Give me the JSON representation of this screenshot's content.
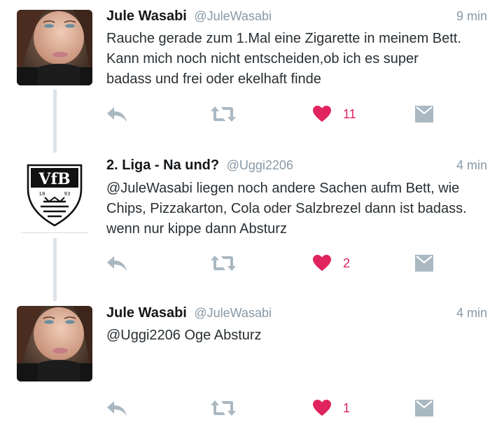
{
  "tweets": [
    {
      "name": "Jule Wasabi",
      "handle": "@JuleWasabi",
      "time": "9 min",
      "text_lines": [
        "Rauche gerade zum 1.Mal eine Zigarette in meinem Bett.",
        "Kann mich noch nicht entscheiden,ob ich es super",
        "badass und frei oder ekelhaft finde"
      ],
      "likes": "11",
      "avatar": "photo-avatar"
    },
    {
      "name": "2. Liga - Na und?",
      "handle": "@Uggi2206",
      "time": "4 min",
      "text_lines": [
        "@JuleWasabi liegen noch andere Sachen aufm Bett, wie",
        "Chips, Pizzakarton, Cola oder Salzbrezel dann ist badass.",
        "wenn nur kippe dann Absturz"
      ],
      "likes": "2",
      "avatar": "vfb-crest-logo",
      "logo_text": "VfB 18 93"
    },
    {
      "name": "Jule Wasabi",
      "handle": "@JuleWasabi",
      "time": "4 min",
      "text_lines": [
        "@Uggi2206 Oge Absturz"
      ],
      "likes": "1",
      "avatar": "photo-avatar"
    }
  ],
  "icons": {
    "reply": "reply-icon",
    "retweet": "retweet-icon",
    "like": "heart-icon",
    "dm": "envelope-icon"
  },
  "colors": {
    "like": "#e0245e",
    "icon_gray": "#aab8c2",
    "secondary_text": "#8899a6",
    "thread_line": "#dde3e8"
  }
}
